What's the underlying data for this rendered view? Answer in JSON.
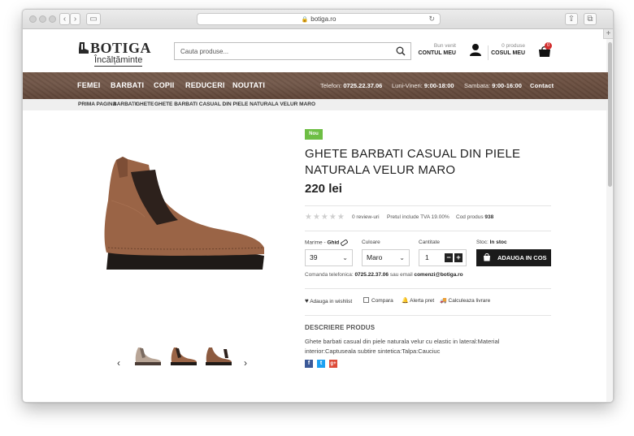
{
  "browser": {
    "url": "botiga.ro"
  },
  "header": {
    "brand": "BOTIGA",
    "brand_sub": "Încălțăminte",
    "search_placeholder": "Cauta produse...",
    "account_greeting": "Bun venit",
    "account_label": "CONTUL MEU",
    "cart_count_text": "0 produse",
    "cart_label": "COSUL MEU",
    "cart_badge": "0"
  },
  "nav": {
    "items": [
      "FEMEI",
      "BARBATI",
      "COPII",
      "REDUCERI",
      "NOUTATI"
    ],
    "phone_label": "Telefon:",
    "phone": "0725.22.37.06",
    "weekday_label": "Luni-Vineri:",
    "weekday_hours": "9:00-18:00",
    "saturday_label": "Sambata:",
    "saturday_hours": "9:00-16:00",
    "contact": "Contact"
  },
  "breadcrumb": [
    "PRIMA PAGINA",
    "BARBATI",
    "GHETE",
    "GHETE BARBATI CASUAL DIN PIELE NATURALA VELUR MARO"
  ],
  "product": {
    "badge": "Nou",
    "title": "GHETE BARBATI CASUAL DIN PIELE NATURALA VELUR MARO",
    "price": "220 lei",
    "reviews": "0 review-uri",
    "vat_note": "Pretul include TVA 19.00%",
    "code_label": "Cod produs",
    "code": "938",
    "size_label": "Marime -",
    "size_guide": "Ghid",
    "size_value": "39",
    "color_label": "Culoare",
    "color_value": "Maro",
    "qty_label": "Cantitate",
    "qty_value": "1",
    "stock_label": "Stoc:",
    "stock_value": "In stoc",
    "add_to_cart": "ADAUGA IN COS",
    "phone_order_label": "Comanda telefonica:",
    "phone_order": "0725.22.37.06",
    "email_label": "sau email",
    "email": "comenzi@botiga.ro",
    "actions": [
      "Adauga in wishlist",
      "Compara",
      "Alerta pret",
      "Calculeaza livrare"
    ],
    "description_heading": "DESCRIERE PRODUS",
    "description": "Ghete barbati casual din piele naturala velur cu elastic in lateral:Material interior:Captuseala subtire sintetica:Talpa:Cauciuc"
  },
  "colors": {
    "nav_brown": "#6b5040",
    "badge_green": "#6ebe44",
    "cart_button": "#1b1b1b",
    "cart_badge_red": "#d32f2f",
    "shoe_suede": "#9a6446"
  }
}
